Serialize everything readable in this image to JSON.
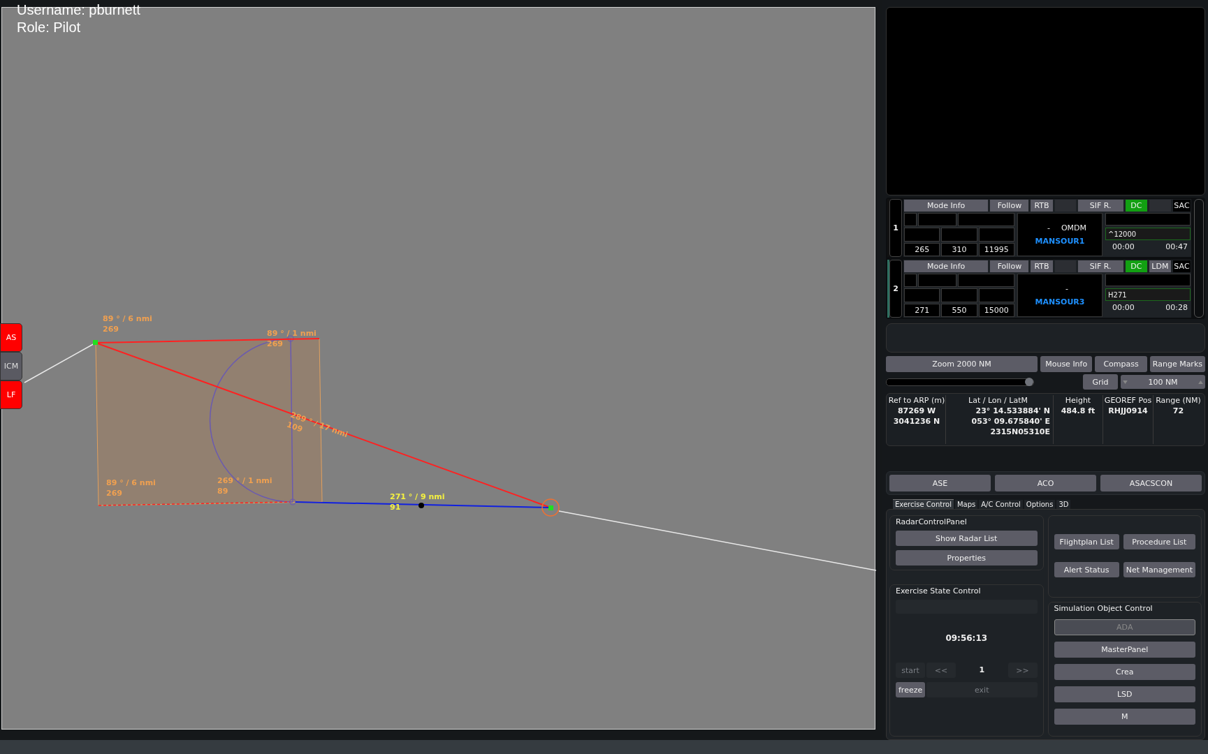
{
  "user": {
    "username": "Username: pburnett",
    "role": "Role: Pilot"
  },
  "side_buttons": [
    {
      "label": "AS",
      "alert": true
    },
    {
      "label": "ICM",
      "alert": false
    },
    {
      "label": "LF",
      "alert": true
    }
  ],
  "map_labels": [
    {
      "bearing": "89 ° / 6 nmi",
      "reverse": "269",
      "color": "#f0a050"
    },
    {
      "bearing": "89 ° / 1 nmi",
      "reverse": "269",
      "color": "#f0a050"
    },
    {
      "bearing": "289 ° / 17 nmi",
      "reverse": "109",
      "color": "#f0a050"
    },
    {
      "bearing": "89 ° / 6 nmi",
      "reverse": "269",
      "color": "#f0a050"
    },
    {
      "bearing": "269 ° / 1 nmi",
      "reverse": "89",
      "color": "#f0a050"
    },
    {
      "bearing": "271 ° / 9 nmi",
      "reverse": "91",
      "color": "#f4f040"
    }
  ],
  "tracks": [
    {
      "number": "1",
      "selected": false,
      "header": [
        {
          "label": "Mode Info",
          "kind": "button"
        },
        {
          "label": "Follow",
          "kind": "button"
        },
        {
          "label": "RTB",
          "kind": "button"
        },
        {
          "kind": "blank"
        },
        {
          "label": "SIF R.",
          "kind": "button"
        },
        {
          "label": "DC",
          "kind": "indicator",
          "on": true
        },
        {
          "kind": "blank"
        },
        {
          "label": "SAC",
          "kind": "tag"
        }
      ],
      "values": [
        "265",
        "310",
        "11995"
      ],
      "route": [
        "-",
        "OMDM"
      ],
      "callsign": "MANSOUR1",
      "field": "^12000",
      "times": [
        "00:00",
        "00:47"
      ]
    },
    {
      "number": "2",
      "selected": true,
      "header": [
        {
          "label": "Mode Info",
          "kind": "button"
        },
        {
          "label": "Follow",
          "kind": "button"
        },
        {
          "label": "RTB",
          "kind": "button"
        },
        {
          "kind": "blank"
        },
        {
          "label": "SIF R.",
          "kind": "button"
        },
        {
          "label": "DC",
          "kind": "indicator",
          "on": true
        },
        {
          "label": "LDM",
          "kind": "button"
        },
        {
          "label": "SAC",
          "kind": "tag"
        }
      ],
      "values": [
        "271",
        "550",
        "15000"
      ],
      "route": [
        "-"
      ],
      "callsign": "MANSOUR3",
      "field": "H271",
      "times": [
        "00:00",
        "00:28"
      ]
    }
  ],
  "zoom": {
    "button": "Zoom 2000 NM",
    "level": 0.97
  },
  "toggles": [
    "Mouse Info",
    "Compass",
    "Range Marks",
    "Grid"
  ],
  "grid_spin": {
    "value": "100 NM"
  },
  "info_table": {
    "columns": [
      {
        "heading": "Ref to ARP (m)",
        "values": [
          "87269 W",
          "3041236 N"
        ]
      },
      {
        "heading": "Lat / Lon / LatM",
        "values": [
          "23° 14.533884' N",
          "053° 09.675840' E",
          "2315N05310E"
        ]
      },
      {
        "heading": "Height",
        "values": [
          "484.8 ft"
        ]
      },
      {
        "heading": "GEOREF Pos",
        "values": [
          "RHJJ0914"
        ]
      },
      {
        "heading": "Range (NM)",
        "values": [
          "72"
        ]
      }
    ]
  },
  "mode_buttons": [
    "ASE",
    "ACO",
    "ASACSCON"
  ],
  "tabs": [
    {
      "label": "Exercise Control",
      "selected": true
    },
    {
      "label": "Maps",
      "selected": false
    },
    {
      "label": "A/C Control",
      "selected": false
    },
    {
      "label": "Options",
      "selected": false
    },
    {
      "label": "3D",
      "selected": false
    }
  ],
  "radar_control": {
    "title": "RadarControlPanel",
    "buttons": [
      "Show Radar List",
      "Properties"
    ]
  },
  "list_buttons": [
    "Flightplan List",
    "Procedure List",
    "Alert Status",
    "Net Management"
  ],
  "exercise_state": {
    "title": "Exercise State Control",
    "recording_bar": {
      "disabled": true
    },
    "time": "09:56:13",
    "step": "1",
    "buttons": [
      {
        "label": "start",
        "disabled": true
      },
      {
        "label": "<<",
        "disabled": true
      },
      {
        "label": ">>",
        "disabled": true
      },
      {
        "label": "freeze",
        "disabled": false
      },
      {
        "label": "exit",
        "disabled": true
      }
    ]
  },
  "simulation": {
    "title": "Simulation Object Control",
    "buttons": [
      {
        "label": "ADA",
        "disabled": true
      },
      {
        "label": "MasterPanel",
        "disabled": false
      },
      {
        "label": "Crea",
        "disabled": false
      },
      {
        "label": "LSD",
        "disabled": false
      },
      {
        "label": "M",
        "disabled": false
      }
    ]
  }
}
